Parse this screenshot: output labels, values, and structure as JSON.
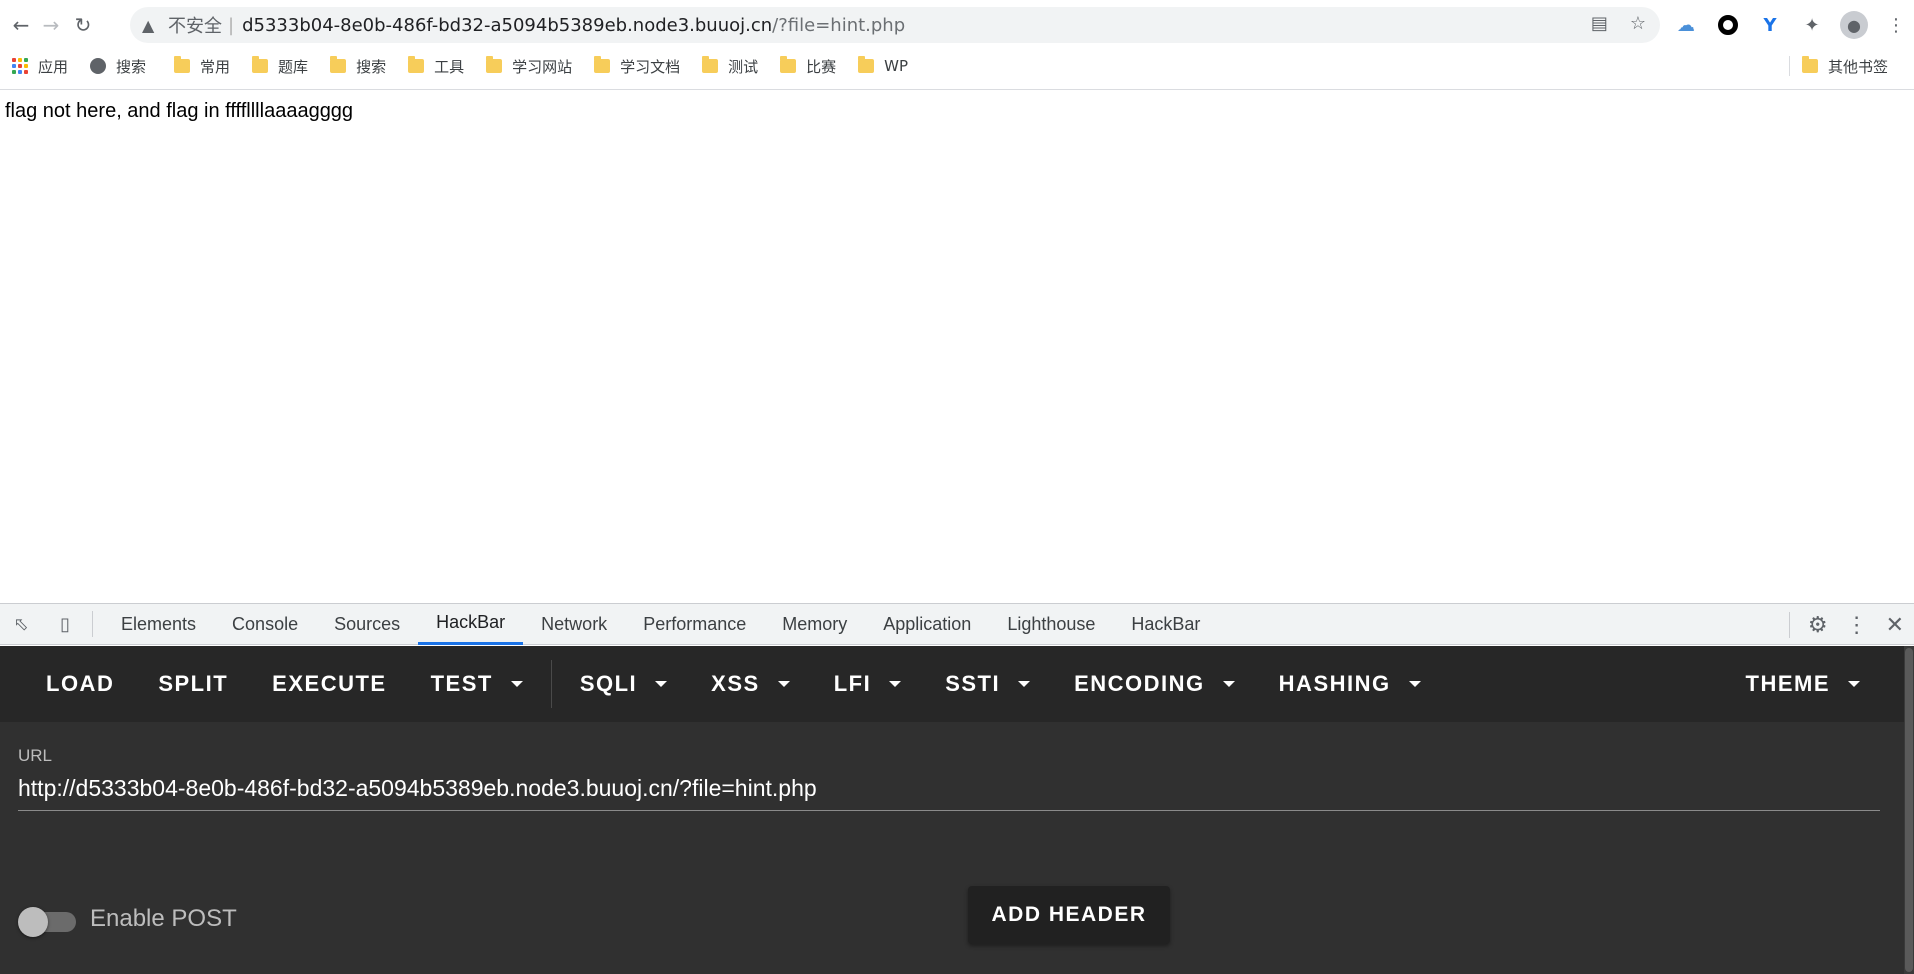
{
  "browser": {
    "security_text": "不安全",
    "url_host": "d5333b04-8e0b-486f-bd32-a5094b5389eb.node3.buuoj.cn",
    "url_path": "/?file=hint.php"
  },
  "bookmarks": {
    "items": [
      {
        "label": "应用",
        "icon": "apps-grid-icon"
      },
      {
        "label": "搜索",
        "icon": "globe-icon"
      },
      {
        "label": "常用",
        "icon": "folder-icon"
      },
      {
        "label": "题库",
        "icon": "folder-icon"
      },
      {
        "label": "搜索",
        "icon": "folder-icon"
      },
      {
        "label": "工具",
        "icon": "folder-icon"
      },
      {
        "label": "学习网站",
        "icon": "folder-icon"
      },
      {
        "label": "学习文档",
        "icon": "folder-icon"
      },
      {
        "label": "测试",
        "icon": "folder-icon"
      },
      {
        "label": "比赛",
        "icon": "folder-icon"
      },
      {
        "label": "WP",
        "icon": "folder-icon"
      }
    ],
    "other": "其他书签"
  },
  "page": {
    "text": "flag not here, and flag in ffffllllaaaagggg"
  },
  "devtools": {
    "tabs": [
      "Elements",
      "Console",
      "Sources",
      "HackBar",
      "Network",
      "Performance",
      "Memory",
      "Application",
      "Lighthouse",
      "HackBar"
    ],
    "active_tab_index": 3
  },
  "hackbar": {
    "menu": {
      "load": "LOAD",
      "split": "SPLIT",
      "execute": "EXECUTE",
      "test": "TEST",
      "sqli": "SQLI",
      "xss": "XSS",
      "lfi": "LFI",
      "ssti": "SSTI",
      "encoding": "ENCODING",
      "hashing": "HASHING",
      "theme": "THEME"
    },
    "url_label": "URL",
    "url_value": "http://d5333b04-8e0b-486f-bd32-a5094b5389eb.node3.buuoj.cn/?file=hint.php",
    "enable_post_label": "Enable POST",
    "enable_post": false,
    "add_header_label": "ADD HEADER"
  },
  "colors": {
    "accent": "#1a73e8",
    "hackbar_bg": "#303030",
    "hackbar_menu_bg": "#272727",
    "folder": "#f7cd5a"
  }
}
